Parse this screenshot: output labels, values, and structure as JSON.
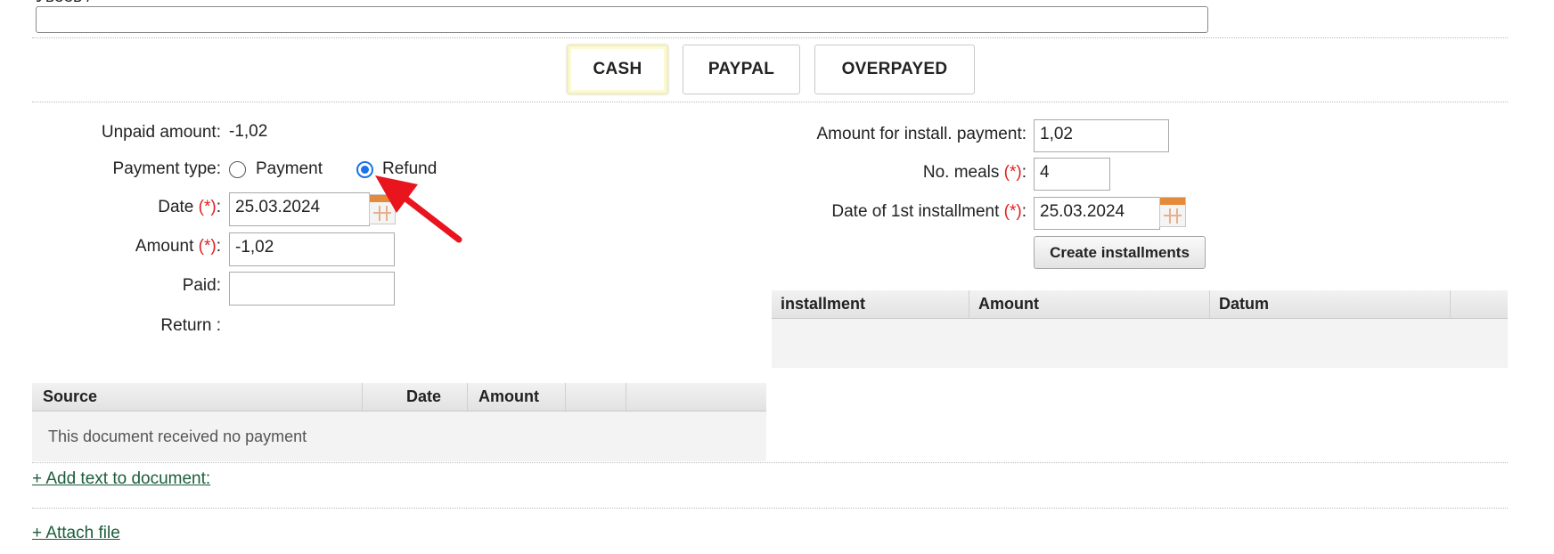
{
  "header": {
    "cutoff_label": "Увеев /"
  },
  "payment_buttons": [
    {
      "label": "CASH",
      "active": true
    },
    {
      "label": "PAYPAL",
      "active": false
    },
    {
      "label": "OVERPAYED",
      "active": false
    }
  ],
  "left_form": {
    "unpaid_label": "Unpaid amount:",
    "unpaid_value": "-1,02",
    "payment_type_label": "Payment type:",
    "payment_option": "Payment",
    "refund_option": "Refund",
    "selected": "Refund",
    "date_label": "Date",
    "date_value": "25.03.2024",
    "amount_label": "Amount",
    "amount_value": "-1,02",
    "paid_label": "Paid:",
    "paid_value": "",
    "return_label": "Return :",
    "required_marker": "(*)",
    "colon": ":"
  },
  "right_form": {
    "install_amount_label": "Amount for install. payment:",
    "install_amount_value": "1,02",
    "meals_label": "No. meals",
    "meals_value": "4",
    "first_install_label": "Date of 1st installment",
    "first_install_value": "25.03.2024",
    "create_button": "Create installments",
    "required_marker": "(*)",
    "colon": ":"
  },
  "installments_table": {
    "columns": [
      "installment",
      "Amount",
      "Datum"
    ]
  },
  "payments_table": {
    "columns": [
      "Source",
      "Date",
      "Amount"
    ],
    "empty_text": "This document received no payment"
  },
  "links": {
    "add_text": "+ Add text to document:",
    "attach_file": "+ Attach file"
  },
  "colors": {
    "required": "#e02020",
    "radio_selected": "#1a73e8",
    "arrow": "#e8141e",
    "link": "#1b5e3b"
  }
}
